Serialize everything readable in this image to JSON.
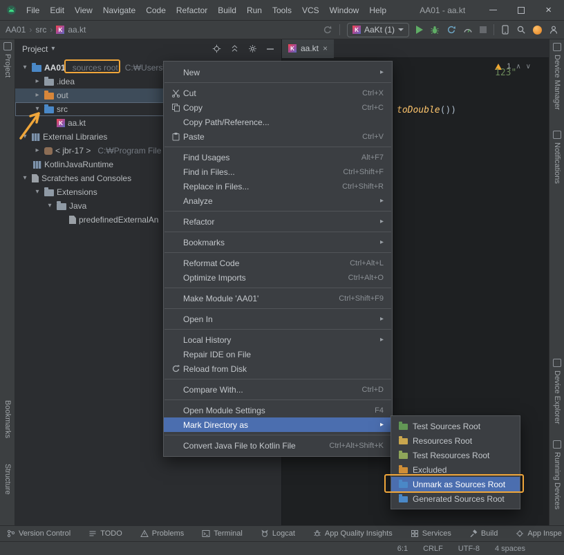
{
  "colors": {
    "annotation": "#f0a63a",
    "menu_selection": "#4b6eaf",
    "run_green": "#5fad65",
    "warning": "#f0a732",
    "kotlin_string": "#6a8759",
    "kotlin_function": "#ffc66d"
  },
  "icons": {
    "chevron_down": "▾",
    "chevron_right": "▸",
    "submenu_arrow": "▸",
    "caret_down": "▾",
    "close": "×",
    "crumb_separator": "›",
    "chevron_up_small": "∧",
    "chevron_down_small": "∨"
  },
  "titlebar": {
    "title": "AA01 - aa.kt",
    "menus": [
      "File",
      "Edit",
      "View",
      "Navigate",
      "Code",
      "Refactor",
      "Build",
      "Run",
      "Tools",
      "VCS",
      "Window",
      "Help"
    ]
  },
  "toolbar": {
    "breadcrumbs": [
      "AA01",
      "src",
      "aa.kt"
    ],
    "run_config_label": "AaKt (1)"
  },
  "strips": {
    "project": "Project",
    "bookmarks": "Bookmarks",
    "structure": "Structure",
    "device_manager": "Device Manager",
    "notifications": "Notifications",
    "device_explorer": "Device Explorer",
    "running_devices": "Running Devices"
  },
  "panel": {
    "title": "Project",
    "tree": [
      {
        "label": "AA01",
        "hint1": "sources root",
        "hint2": "C:₩Users₩"
      },
      {
        "label": ".idea"
      },
      {
        "label": "out"
      },
      {
        "label": "src"
      },
      {
        "label": "aa.kt"
      },
      {
        "label": "External Libraries"
      },
      {
        "label": "< jbr-17 >",
        "hint1": "C:₩Program File"
      },
      {
        "label": "KotlinJavaRuntime"
      },
      {
        "label": "Scratches and Consoles"
      },
      {
        "label": "Extensions"
      },
      {
        "label": "Java"
      },
      {
        "label": "predefinedExternalAn"
      }
    ]
  },
  "editor": {
    "tab_label": "aa.kt",
    "warning_count": "1",
    "code_fragment_string": "123\"",
    "code_fragment_function": "toDouble",
    "code_fragment_parens": "())"
  },
  "menu": {
    "items": [
      {
        "label": "New"
      },
      {
        "label": "Cut",
        "shortcut": "Ctrl+X"
      },
      {
        "label": "Copy",
        "shortcut": "Ctrl+C"
      },
      {
        "label": "Copy Path/Reference..."
      },
      {
        "label": "Paste",
        "shortcut": "Ctrl+V"
      },
      {
        "label": "Find Usages",
        "shortcut": "Alt+F7"
      },
      {
        "label": "Find in Files...",
        "shortcut": "Ctrl+Shift+F"
      },
      {
        "label": "Replace in Files...",
        "shortcut": "Ctrl+Shift+R"
      },
      {
        "label": "Analyze"
      },
      {
        "label": "Refactor"
      },
      {
        "label": "Bookmarks"
      },
      {
        "label": "Reformat Code",
        "shortcut": "Ctrl+Alt+L"
      },
      {
        "label": "Optimize Imports",
        "shortcut": "Ctrl+Alt+O"
      },
      {
        "label": "Make Module 'AA01'",
        "shortcut": "Ctrl+Shift+F9"
      },
      {
        "label": "Open In"
      },
      {
        "label": "Local History"
      },
      {
        "label": "Repair IDE on File"
      },
      {
        "label": "Reload from Disk"
      },
      {
        "label": "Compare With...",
        "shortcut": "Ctrl+D"
      },
      {
        "label": "Open Module Settings",
        "shortcut": "F4"
      },
      {
        "label": "Mark Directory as"
      },
      {
        "label": "Convert Java File to Kotlin File",
        "shortcut": "Ctrl+Alt+Shift+K"
      }
    ]
  },
  "submenu": {
    "items": [
      {
        "label": "Test Sources Root"
      },
      {
        "label": "Resources Root"
      },
      {
        "label": "Test Resources Root"
      },
      {
        "label": "Excluded"
      },
      {
        "label": "Unmark as Sources Root"
      },
      {
        "label": "Generated Sources Root"
      }
    ]
  },
  "status": {
    "buttons": [
      "Version Control",
      "TODO",
      "Problems",
      "Terminal",
      "Logcat",
      "App Quality Insights",
      "Services",
      "Build",
      "App Inspe"
    ],
    "right": [
      "6:1",
      "CRLF",
      "UTF-8",
      "4 spaces"
    ]
  }
}
